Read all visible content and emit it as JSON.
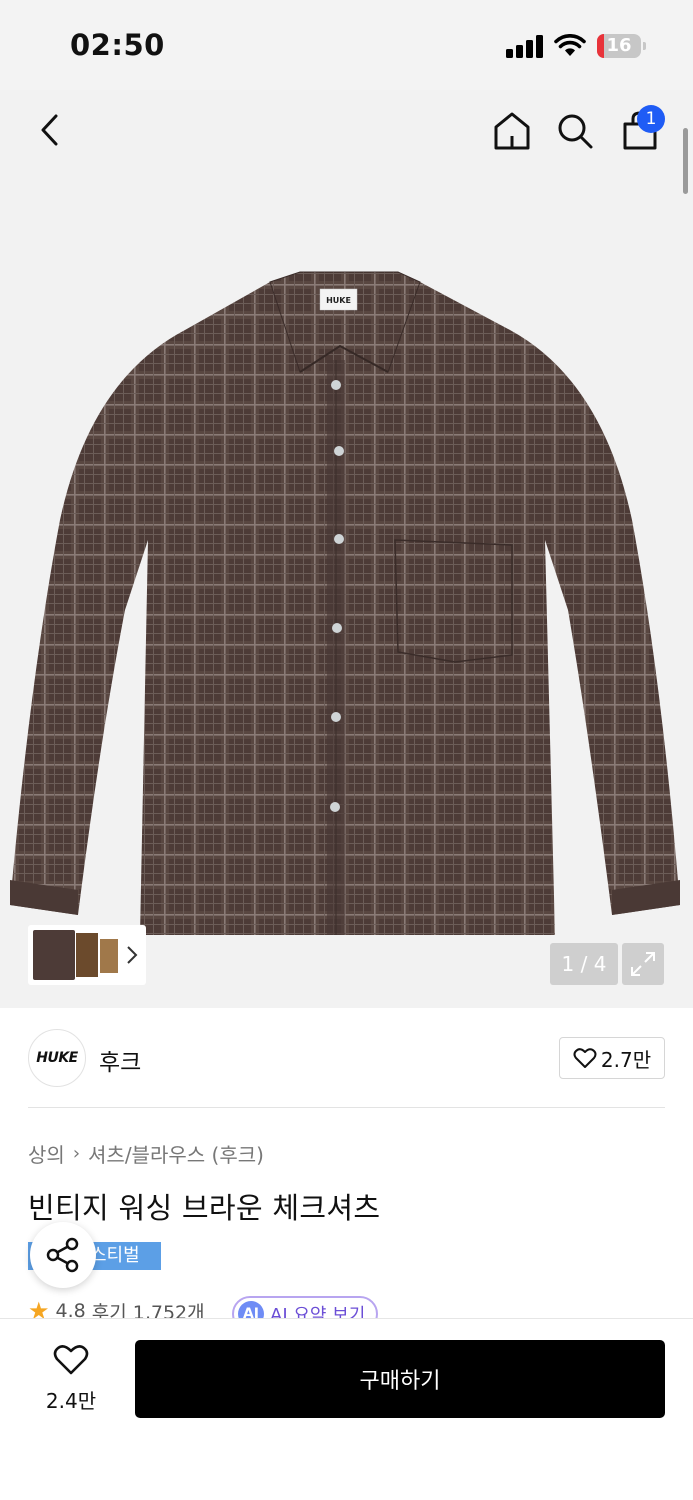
{
  "status_bar": {
    "time": "02:50",
    "battery": "16",
    "battery_level": 0.16
  },
  "nav": {
    "cart_count": "1"
  },
  "gallery": {
    "counter": "1 / 4",
    "brand_tag_on_shirt": "HUKE"
  },
  "brand": {
    "logo_text": "HUKE",
    "name": "후크",
    "likes": "2.7만"
  },
  "breadcrumb": [
    "상의",
    "셔츠/블라우스 (후크)"
  ],
  "product": {
    "title": "빈티지 워싱 브라운 체크셔츠",
    "tag": "스티벌",
    "rating": "4.8",
    "reviews": "후기 1,752개",
    "ai_label": "AI",
    "ai_summary": "AI 요약 보기"
  },
  "bottom_bar": {
    "wish_count": "2.4만",
    "buy_label": "구매하기"
  },
  "colors": {
    "accent_blue": "#1f5cf5",
    "tag_blue": "#5c9fe6",
    "ai_purple": "#6b4ed6",
    "shirt_brown": "#4a3a36",
    "star": "#f5a623"
  }
}
